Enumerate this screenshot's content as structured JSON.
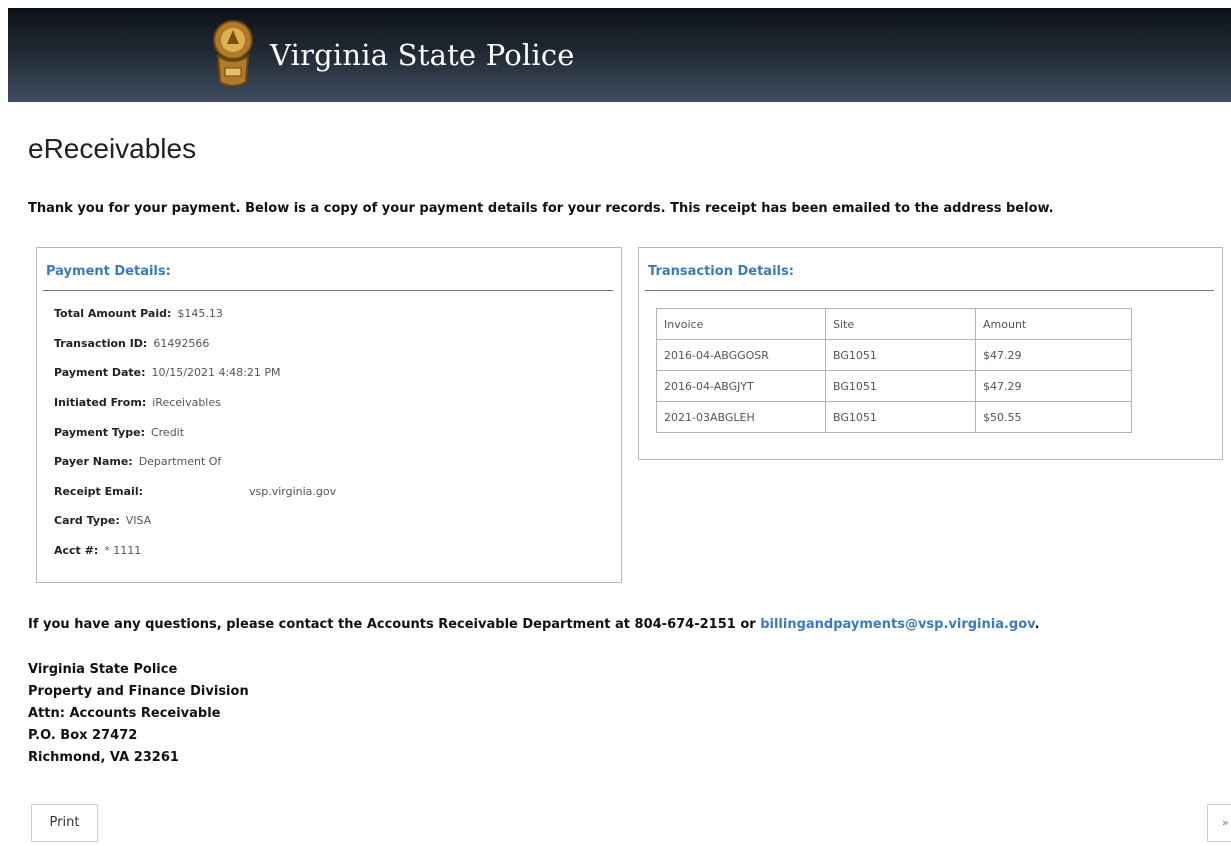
{
  "header": {
    "brand": "Virginia State Police",
    "badge_icon": "state-police-badge",
    "gradient_top": "#0e1218",
    "gradient_bottom": "#3f4d5e"
  },
  "page": {
    "title": "eReceivables",
    "thanks_message": "Thank you for your payment. Below is a copy of your payment details for your records. This receipt has been emailed to the address below."
  },
  "payment_details": {
    "heading": "Payment Details:",
    "rows": [
      {
        "label": "Total Amount Paid:",
        "value": "$145.13"
      },
      {
        "label": "Transaction ID:",
        "value": "61492566"
      },
      {
        "label": "Payment Date:",
        "value": "10/15/2021 4:48:21 PM"
      },
      {
        "label": "Initiated From:",
        "value": "iReceivables"
      },
      {
        "label": "Payment Type:",
        "value": "Credit"
      },
      {
        "label": "Payer Name:",
        "value": "Department Of"
      },
      {
        "label": "Receipt Email:",
        "value": "vsp.virginia.gov"
      },
      {
        "label": "Card Type:",
        "value": "VISA"
      },
      {
        "label": "Acct #:",
        "value": "* 1111"
      }
    ]
  },
  "transaction_details": {
    "heading": "Transaction Details:",
    "columns": [
      "Invoice",
      "Site",
      "Amount"
    ],
    "rows": [
      [
        "2016-04-ABGGOSR",
        "BG1051",
        "$47.29"
      ],
      [
        "2016-04-ABGJYT",
        "BG1051",
        "$47.29"
      ],
      [
        "2021-03ABGLEH",
        "BG1051",
        "$50.55"
      ]
    ]
  },
  "contact": {
    "text": "If you have any questions, please contact the Accounts Receivable Department at 804-674-2151 or",
    "email": "billingandpayments@vsp.virginia.gov",
    "end": ".",
    "link_color": "#3a7bbf"
  },
  "address": {
    "lines": [
      "Virginia State Police",
      "Property and Finance Division",
      "Attn: Accounts Receivable",
      "P.O. Box 27472",
      "Richmond, VA 23261"
    ]
  },
  "buttons": {
    "print": "Print",
    "next": "»"
  }
}
